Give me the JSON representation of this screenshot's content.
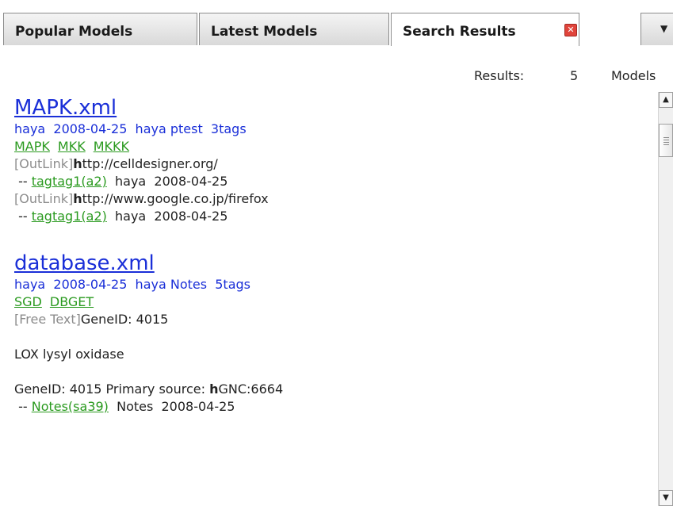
{
  "tabs": [
    {
      "label": "Popular Models"
    },
    {
      "label": "Latest Models"
    },
    {
      "label": "Search Results"
    }
  ],
  "results": {
    "label": "Results:",
    "count": "5",
    "unit": "Models"
  },
  "models": [
    {
      "title": "MAPK.xml",
      "meta": "haya  2008-04-25  haya ptest  3tags",
      "tags": [
        "MAPK",
        "MKK",
        "MKKK"
      ],
      "lines": [
        {
          "kind": "[OutLink]",
          "first": "h",
          "rest": "ttp://celldesigner.org/"
        },
        {
          "prefix": " -- ",
          "link": "tagtag1(a2)",
          "suffix": "  haya  2008-04-25"
        },
        {
          "kind": "[OutLink]",
          "first": "h",
          "rest": "ttp://www.google.co.jp/firefox"
        },
        {
          "prefix": " -- ",
          "link": "tagtag1(a2)",
          "suffix": "  haya  2008-04-25"
        }
      ]
    },
    {
      "title": "database.xml",
      "meta": "haya  2008-04-25  haya Notes  5tags",
      "tags": [
        "SGD",
        "DBGET"
      ],
      "lines": [
        {
          "kind": "[Free Text]",
          "text": "GeneID: 4015"
        },
        {
          "text": "LOX lysyl oxidase"
        },
        {
          "pre": "GeneID: 4015 Primary source: ",
          "bold": "h",
          "post": "GNC:6664"
        },
        {
          "prefix": " -- ",
          "link": "Notes(sa39)",
          "suffix": "  Notes  2008-04-25"
        }
      ]
    }
  ],
  "icons": {
    "tab_close": "close-icon",
    "tab_menu": "chevron-down-icon",
    "scroll_up": "arrow-up-icon",
    "scroll_down": "arrow-down-icon"
  },
  "colors": {
    "link_blue": "#1a2fd8",
    "tag_green": "#2a9a1f",
    "muted_gray": "#8c8c8c",
    "close_red": "#e0443b"
  }
}
